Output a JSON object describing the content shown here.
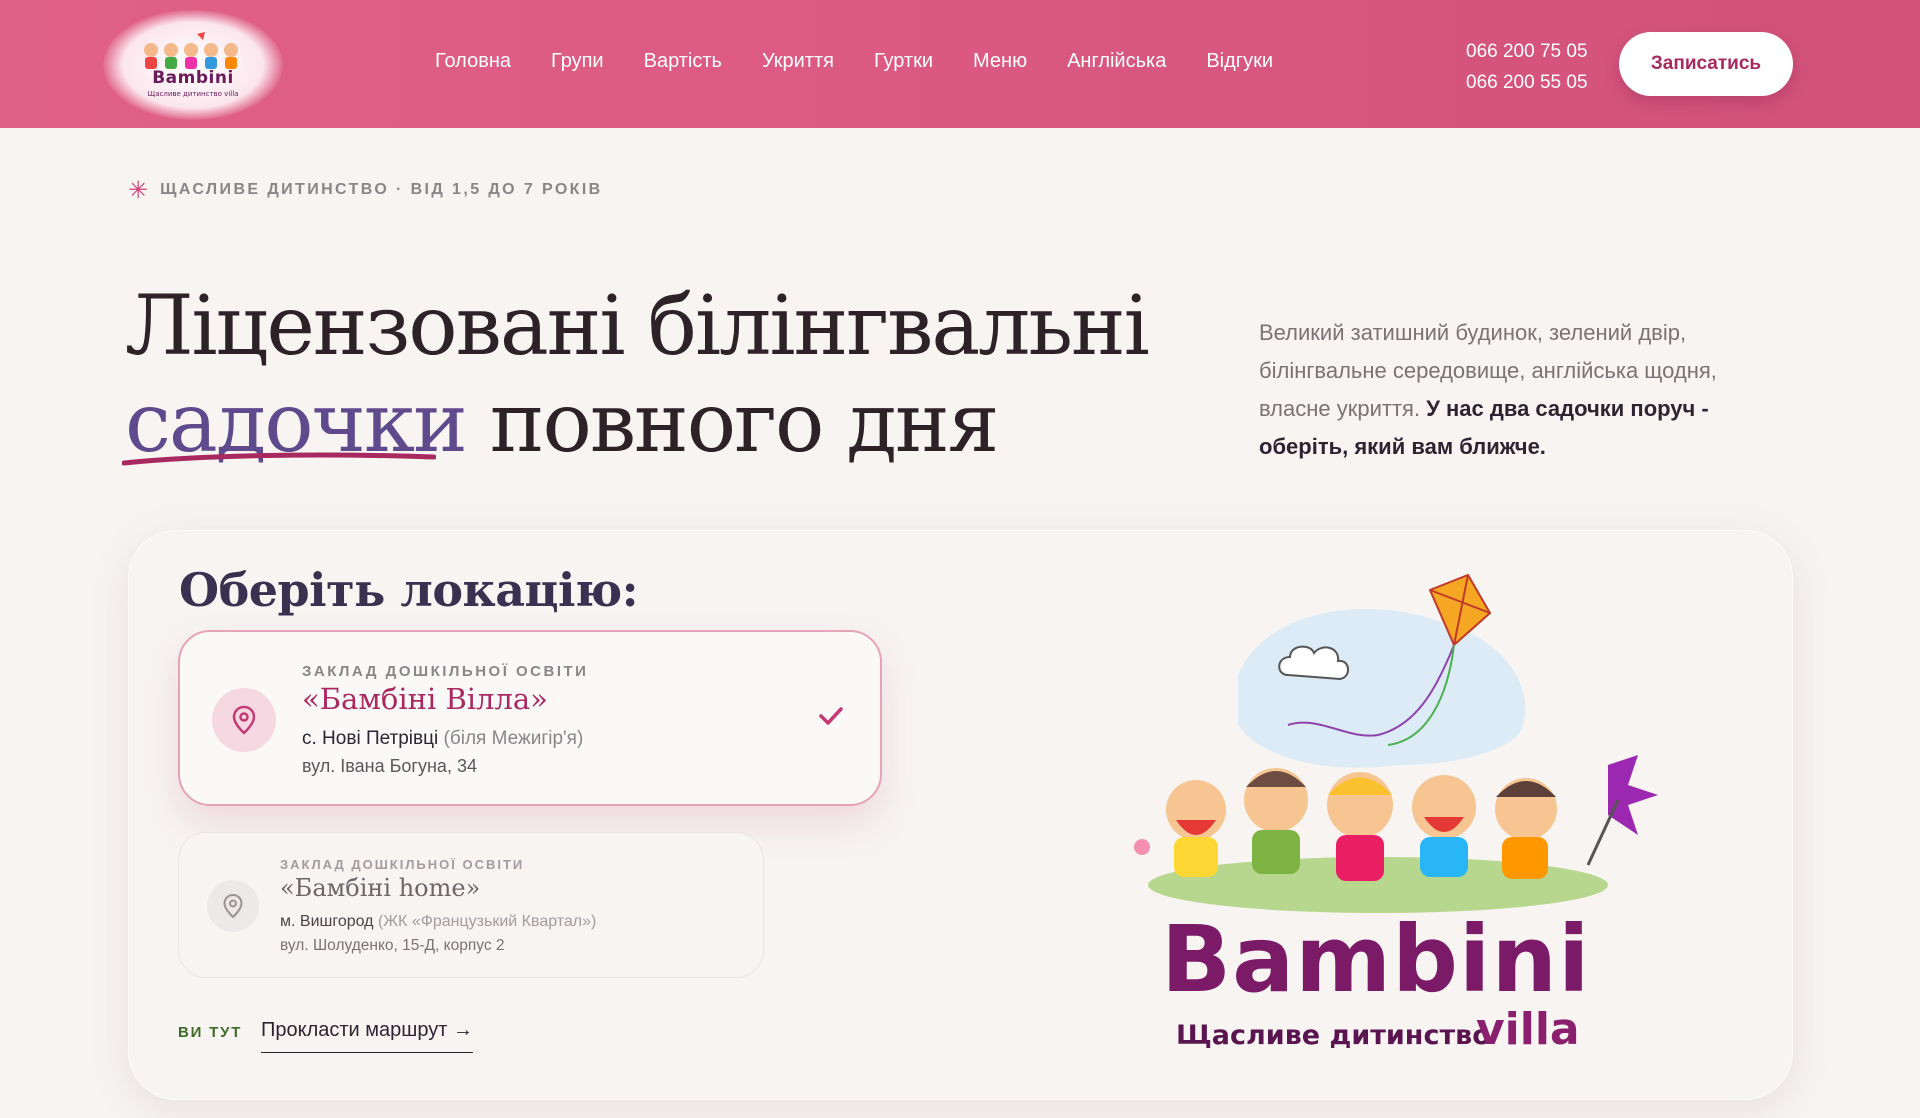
{
  "header": {
    "logo": {
      "brand": "Bambini",
      "tagline": "Щасливе дитинство villa"
    },
    "nav": [
      "Головна",
      "Групи",
      "Вартість",
      "Укриття",
      "Гуртки",
      "Меню",
      "Англійська",
      "Відгуки"
    ],
    "phones": [
      "066 200 75 05",
      "066 200 55 05"
    ],
    "cta_label": "Записатись"
  },
  "hero": {
    "eyebrow": "ЩАСЛИВЕ ДИТИНСТВО · ВІД 1,5 ДО 7 РОКІВ",
    "title_line1": "Ліцензовані білінгвальні",
    "title_accent": "садочки",
    "title_rest": " повного дня",
    "lead": "Великий затишний будинок, зелений двір, білінгвальне середовище, англійська щодня, власне укриття. ",
    "lead_bold": "У нас два садочки поруч - оберіть, який вам ближче."
  },
  "locations": {
    "title": "Оберіть локацію:",
    "items": [
      {
        "kind": "ЗАКЛАД ДОШКІЛЬНОЇ ОСВІТИ",
        "name": "«Бамбіні Вілла»",
        "city": "с. Нові Петрівці",
        "note": "(біля Межигір'я)",
        "street": "вул. Івана Богуна, 34",
        "selected": true
      },
      {
        "kind": "ЗАКЛАД ДОШКІЛЬНОЇ ОСВІТИ",
        "name": "«Бамбіні home»",
        "city": "м. Вишгород",
        "note": "(ЖК «Французький Квартал»)",
        "street": "вул. Шолуденко, 15-Д, корпус 2",
        "selected": false
      }
    ],
    "you_are_here": "ВИ ТУТ",
    "route_label": "Прокласти маршрут  →"
  },
  "illustration": {
    "brand": "Bambini",
    "subtitle": "Щасливе дитинство",
    "suffix": "villa"
  },
  "colors": {
    "header": "#dc5a83",
    "accent": "#a8295f",
    "title_accent": "#5e4a8c",
    "brand_purple": "#7b1a66"
  }
}
